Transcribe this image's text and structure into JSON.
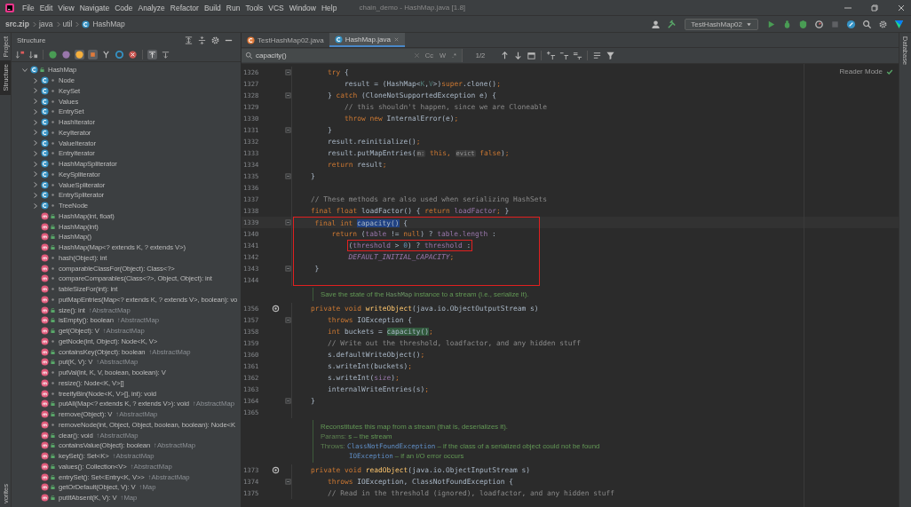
{
  "window": {
    "title": "chain_demo - HashMap.java [1.8]"
  },
  "menu": [
    "File",
    "Edit",
    "View",
    "Navigate",
    "Code",
    "Analyze",
    "Refactor",
    "Build",
    "Run",
    "Tools",
    "VCS",
    "Window",
    "Help"
  ],
  "breadcrumbs": [
    {
      "label": "src.zip",
      "kind": "archive"
    },
    {
      "label": "java",
      "kind": "folder"
    },
    {
      "label": "util",
      "kind": "folder"
    },
    {
      "label": "HashMap",
      "kind": "class"
    }
  ],
  "run_config": "TestHashMap02",
  "left_stripe": [
    {
      "label": "Project",
      "selected": false
    },
    {
      "label": "Structure",
      "selected": true
    }
  ],
  "left_stripe_bottom": "vorites",
  "right_stripe": "Database",
  "structure": {
    "title": "Structure",
    "root": {
      "name": "HashMap",
      "expanded": true,
      "public": true,
      "children": [
        {
          "kind": "class",
          "name": "Node",
          "public": false,
          "expanded": false
        },
        {
          "kind": "class",
          "name": "KeySet",
          "public": false,
          "expanded": false
        },
        {
          "kind": "class",
          "name": "Values",
          "public": false,
          "expanded": false
        },
        {
          "kind": "class",
          "name": "EntrySet",
          "public": false,
          "expanded": false
        },
        {
          "kind": "class",
          "name": "HashIterator",
          "public": false,
          "expanded": false
        },
        {
          "kind": "class",
          "name": "KeyIterator",
          "public": false,
          "expanded": false
        },
        {
          "kind": "class",
          "name": "ValueIterator",
          "public": false,
          "expanded": false
        },
        {
          "kind": "class",
          "name": "EntryIterator",
          "public": false,
          "expanded": false
        },
        {
          "kind": "class",
          "name": "HashMapSpliterator",
          "public": false,
          "expanded": false
        },
        {
          "kind": "class",
          "name": "KeySpliterator",
          "public": false,
          "expanded": false
        },
        {
          "kind": "class",
          "name": "ValueSpliterator",
          "public": false,
          "expanded": false
        },
        {
          "kind": "class",
          "name": "EntrySpliterator",
          "public": false,
          "expanded": false
        },
        {
          "kind": "class",
          "name": "TreeNode",
          "public": false,
          "expanded": false
        },
        {
          "kind": "method",
          "name": "HashMap(int, float)",
          "public": true
        },
        {
          "kind": "method",
          "name": "HashMap(int)",
          "public": true
        },
        {
          "kind": "method",
          "name": "HashMap()",
          "public": true
        },
        {
          "kind": "method",
          "name": "HashMap(Map<? extends K, ? extends V>)",
          "public": true
        },
        {
          "kind": "method",
          "name": "hash(Object): int",
          "public": false
        },
        {
          "kind": "method",
          "name": "comparableClassFor(Object): Class<?>",
          "public": false
        },
        {
          "kind": "method",
          "name": "compareComparables(Class<?>, Object, Object): int",
          "public": false
        },
        {
          "kind": "method",
          "name": "tableSizeFor(int): int",
          "public": false
        },
        {
          "kind": "method",
          "name": "putMapEntries(Map<? extends K, ? extends V>, boolean): vo",
          "public": false
        },
        {
          "kind": "method",
          "name": "size(): int",
          "inherited": "↑AbstractMap",
          "public": true
        },
        {
          "kind": "method",
          "name": "isEmpty(): boolean",
          "inherited": "↑AbstractMap",
          "public": true
        },
        {
          "kind": "method",
          "name": "get(Object): V",
          "inherited": "↑AbstractMap",
          "public": true
        },
        {
          "kind": "method",
          "name": "getNode(int, Object): Node<K, V>",
          "public": false
        },
        {
          "kind": "method",
          "name": "containsKey(Object): boolean",
          "inherited": "↑AbstractMap",
          "public": true
        },
        {
          "kind": "method",
          "name": "put(K, V): V",
          "inherited": "↑AbstractMap",
          "public": true
        },
        {
          "kind": "method",
          "name": "putVal(int, K, V, boolean, boolean): V",
          "public": false
        },
        {
          "kind": "method",
          "name": "resize(): Node<K, V>[]",
          "public": false
        },
        {
          "kind": "method",
          "name": "treeifyBin(Node<K, V>[], int): void",
          "public": false
        },
        {
          "kind": "method",
          "name": "putAll(Map<? extends K, ? extends V>): void",
          "inherited": "↑AbstractMap",
          "public": true
        },
        {
          "kind": "method",
          "name": "remove(Object): V",
          "inherited": "↑AbstractMap",
          "public": true
        },
        {
          "kind": "method",
          "name": "removeNode(int, Object, Object, boolean, boolean): Node<K",
          "public": false
        },
        {
          "kind": "method",
          "name": "clear(): void",
          "inherited": "↑AbstractMap",
          "public": true
        },
        {
          "kind": "method",
          "name": "containsValue(Object): boolean",
          "inherited": "↑AbstractMap",
          "public": true
        },
        {
          "kind": "method",
          "name": "keySet(): Set<K>",
          "inherited": "↑AbstractMap",
          "public": true
        },
        {
          "kind": "method",
          "name": "values(): Collection<V>",
          "inherited": "↑AbstractMap",
          "public": true
        },
        {
          "kind": "method",
          "name": "entrySet(): Set<Entry<K, V>>",
          "inherited": "↑AbstractMap",
          "public": true
        },
        {
          "kind": "method",
          "name": "getOrDefault(Object, V): V",
          "inherited": "↑Map",
          "public": true
        },
        {
          "kind": "method",
          "name": "putIfAbsent(K, V): V",
          "inherited": "↑Map",
          "public": true
        }
      ]
    }
  },
  "tabs": [
    {
      "label": "TestHashMap02.java",
      "selected": false
    },
    {
      "label": "HashMap.java",
      "selected": true
    }
  ],
  "search": {
    "value": "capacity()",
    "options": [
      {
        "label": "Cc",
        "selected": false
      },
      {
        "label": "W",
        "selected": false
      },
      {
        "label": ".*",
        "selected": false
      }
    ],
    "match_count": "1/2"
  },
  "reader_mode": "Reader Mode",
  "code": [
    {
      "kind": "line",
      "number": "1326",
      "fold": true,
      "segments": [
        {
          "text": "        try",
          "kind": "kw"
        },
        {
          "text": " {",
          "kind": "p"
        }
      ]
    },
    {
      "kind": "line",
      "number": "1327",
      "segments": [
        {
          "text": "            result = (HashMap<",
          "kind": "p"
        },
        {
          "text": "K",
          "kind": "tp"
        },
        {
          "text": ",",
          "kind": "p"
        },
        {
          "text": "V",
          "kind": "tp"
        },
        {
          "text": ">)",
          "kind": "p"
        },
        {
          "text": "super",
          "kind": "kw"
        },
        {
          "text": ".clone()",
          "kind": "p"
        },
        {
          "text": ";",
          "kind": "kw"
        }
      ]
    },
    {
      "kind": "line",
      "number": "1328",
      "fold": true,
      "segments": [
        {
          "text": "        } ",
          "kind": "p"
        },
        {
          "text": "catch",
          "kind": "kw"
        },
        {
          "text": " (CloneNotSupportedException e) {",
          "kind": "p"
        }
      ]
    },
    {
      "kind": "line",
      "number": "1329",
      "segments": [
        {
          "text": "            // this shouldn't happen, since we are Cloneable",
          "kind": "comment"
        }
      ]
    },
    {
      "kind": "line",
      "number": "1330",
      "segments": [
        {
          "text": "            throw new",
          "kind": "kw"
        },
        {
          "text": " InternalError(e)",
          "kind": "p"
        },
        {
          "text": ";",
          "kind": "kw"
        }
      ]
    },
    {
      "kind": "line",
      "number": "1331",
      "fold": true,
      "segments": [
        {
          "text": "        }",
          "kind": "p"
        }
      ]
    },
    {
      "kind": "line",
      "number": "1332",
      "segments": [
        {
          "text": "        result.reinitialize()",
          "kind": "p"
        },
        {
          "text": ";",
          "kind": "kw"
        }
      ]
    },
    {
      "kind": "line",
      "number": "1333",
      "segments": [
        {
          "text": "        result.putMapEntries(",
          "kind": "p"
        },
        {
          "text": "m:",
          "kind": "hint"
        },
        {
          "text": " this",
          "kind": "kw"
        },
        {
          "text": ", ",
          "kind": "kw"
        },
        {
          "text": "evict",
          "kind": "hint"
        },
        {
          "text": " false",
          "kind": "kw"
        },
        {
          "text": ")",
          "kind": "p"
        },
        {
          "text": ";",
          "kind": "kw"
        }
      ]
    },
    {
      "kind": "line",
      "number": "1334",
      "segments": [
        {
          "text": "        return",
          "kind": "kw"
        },
        {
          "text": " result",
          "kind": "p"
        },
        {
          "text": ";",
          "kind": "kw"
        }
      ]
    },
    {
      "kind": "line",
      "number": "1335",
      "fold": true,
      "segments": [
        {
          "text": "    }",
          "kind": "p"
        }
      ]
    },
    {
      "kind": "line",
      "number": "1336"
    },
    {
      "kind": "line",
      "number": "1337",
      "segments": [
        {
          "text": "    // These methods are also used when serializing HashSets",
          "kind": "comment"
        }
      ]
    },
    {
      "kind": "line",
      "number": "1338",
      "segments": [
        {
          "text": "    final float",
          "kind": "kw"
        },
        {
          "text": " loadFactor() { ",
          "kind": "p"
        },
        {
          "text": "return",
          "kind": "kw"
        },
        {
          "text": " loadFactor",
          "kind": "field"
        },
        {
          "text": ";",
          "kind": "kw"
        },
        {
          "text": " }",
          "kind": "p"
        }
      ]
    },
    {
      "kind": "line",
      "number": "1339",
      "fold": true,
      "current": true,
      "boxed": true,
      "segments": [
        {
          "text": "    final int ",
          "kind": "kw"
        },
        {
          "text": "capacity()",
          "kind": "selected"
        },
        {
          "text": " {",
          "kind": "p"
        }
      ]
    },
    {
      "kind": "line",
      "number": "1340",
      "boxed": true,
      "segments": [
        {
          "text": "        return",
          "kind": "kw"
        },
        {
          "text": " (",
          "kind": "p"
        },
        {
          "text": "table",
          "kind": "field"
        },
        {
          "text": " != ",
          "kind": "p"
        },
        {
          "text": "null",
          "kind": "kw"
        },
        {
          "text": ") ? ",
          "kind": "p"
        },
        {
          "text": "table.length",
          "kind": "field"
        },
        {
          "text": " :",
          "kind": "p"
        }
      ]
    },
    {
      "kind": "line",
      "number": "1341",
      "boxed": true,
      "segments": [
        {
          "kind": "box",
          "segments": [
            {
              "text": "            (",
              "kind": "p"
            },
            {
              "text": "threshold",
              "kind": "field"
            },
            {
              "text": " > ",
              "kind": "p"
            },
            {
              "text": "0",
              "kind": "num"
            },
            {
              "text": ") ? ",
              "kind": "p"
            },
            {
              "text": "threshold",
              "kind": "field"
            },
            {
              "text": " :",
              "kind": "p"
            }
          ]
        }
      ]
    },
    {
      "kind": "line",
      "number": "1342",
      "boxed": true,
      "segments": [
        {
          "text": "            DEFAULT_INITIAL_CAPACITY",
          "kind": "const"
        },
        {
          "text": ";",
          "kind": "kw"
        }
      ]
    },
    {
      "kind": "line",
      "number": "1343",
      "fold": true,
      "boxed": true,
      "segments": [
        {
          "text": "    }",
          "kind": "p"
        }
      ]
    },
    {
      "kind": "line",
      "number": "1344",
      "boxed": true
    },
    {
      "kind": "doc",
      "rows": [
        {
          "kind": "plain",
          "segments": [
            {
              "text": "Save the state of the ",
              "kind": "doc"
            },
            {
              "text": "HashMap",
              "kind": "doc-code"
            },
            {
              "text": " instance to a stream (i.e., serialize it).",
              "kind": "doc"
            }
          ]
        }
      ]
    },
    {
      "kind": "line",
      "number": "1356",
      "override": true,
      "segments": [
        {
          "text": "    private void ",
          "kind": "kw"
        },
        {
          "text": "writeObject",
          "kind": "method"
        },
        {
          "text": "(java.io.ObjectOutputStream s)",
          "kind": "p"
        }
      ]
    },
    {
      "kind": "line",
      "number": "1357",
      "fold": true,
      "segments": [
        {
          "text": "        throws",
          "kind": "kw"
        },
        {
          "text": " IOException {",
          "kind": "p"
        }
      ]
    },
    {
      "kind": "line",
      "number": "1358",
      "segments": [
        {
          "text": "        int",
          "kind": "kw"
        },
        {
          "text": " buckets = ",
          "kind": "p"
        },
        {
          "text": "capacity()",
          "kind": "match"
        },
        {
          "text": ";",
          "kind": "kw"
        }
      ]
    },
    {
      "kind": "line",
      "number": "1359",
      "segments": [
        {
          "text": "        // Write out the threshold, loadfactor, and any hidden stuff",
          "kind": "comment"
        }
      ]
    },
    {
      "kind": "line",
      "number": "1360",
      "segments": [
        {
          "text": "        s.defaultWriteObject()",
          "kind": "p"
        },
        {
          "text": ";",
          "kind": "kw"
        }
      ]
    },
    {
      "kind": "line",
      "number": "1361",
      "segments": [
        {
          "text": "        s.writeInt(buckets)",
          "kind": "p"
        },
        {
          "text": ";",
          "kind": "kw"
        }
      ]
    },
    {
      "kind": "line",
      "number": "1362",
      "segments": [
        {
          "text": "        s.writeInt(",
          "kind": "p"
        },
        {
          "text": "size",
          "kind": "field"
        },
        {
          "text": ")",
          "kind": "p"
        },
        {
          "text": ";",
          "kind": "kw"
        }
      ]
    },
    {
      "kind": "line",
      "number": "1363",
      "segments": [
        {
          "text": "        internalWriteEntries(s)",
          "kind": "p"
        },
        {
          "text": ";",
          "kind": "kw"
        }
      ]
    },
    {
      "kind": "line",
      "number": "1364",
      "fold": true,
      "segments": [
        {
          "text": "    }",
          "kind": "p"
        }
      ]
    },
    {
      "kind": "line",
      "number": "1365"
    },
    {
      "kind": "doc",
      "rows": [
        {
          "kind": "plain",
          "segments": [
            {
              "text": "Reconstitutes this map from a stream (that is, deserializes it).",
              "kind": "doc"
            }
          ]
        },
        {
          "kind": "plain",
          "segments": [
            {
              "text": "Params: ",
              "kind": "doc-label"
            },
            {
              "text": "s – the stream",
              "kind": "doc"
            }
          ]
        },
        {
          "kind": "plain",
          "segments": [
            {
              "text": "Throws: ",
              "kind": "doc-label"
            },
            {
              "text": "ClassNotFoundException",
              "kind": "doc-link"
            },
            {
              "text": " – if the class of a serialized object could not be found",
              "kind": "doc"
            }
          ]
        },
        {
          "kind": "continuation",
          "segments": [
            {
              "text": "IOException",
              "kind": "doc-link"
            },
            {
              "text": " – if an I/O error occurs",
              "kind": "doc"
            }
          ]
        }
      ]
    },
    {
      "kind": "line",
      "number": "1373",
      "override": true,
      "segments": [
        {
          "text": "    private void ",
          "kind": "kw"
        },
        {
          "text": "readObject",
          "kind": "method"
        },
        {
          "text": "(java.io.ObjectInputStream s)",
          "kind": "p"
        }
      ]
    },
    {
      "kind": "line",
      "number": "1374",
      "fold": true,
      "segments": [
        {
          "text": "        throws",
          "kind": "kw"
        },
        {
          "text": " IOException, ClassNotFoundException {",
          "kind": "p"
        }
      ]
    },
    {
      "kind": "line",
      "number": "1375",
      "segments": [
        {
          "text": "        // Read in the threshold (ignored), loadfactor, and any hidden stuff",
          "kind": "comment"
        }
      ]
    }
  ]
}
